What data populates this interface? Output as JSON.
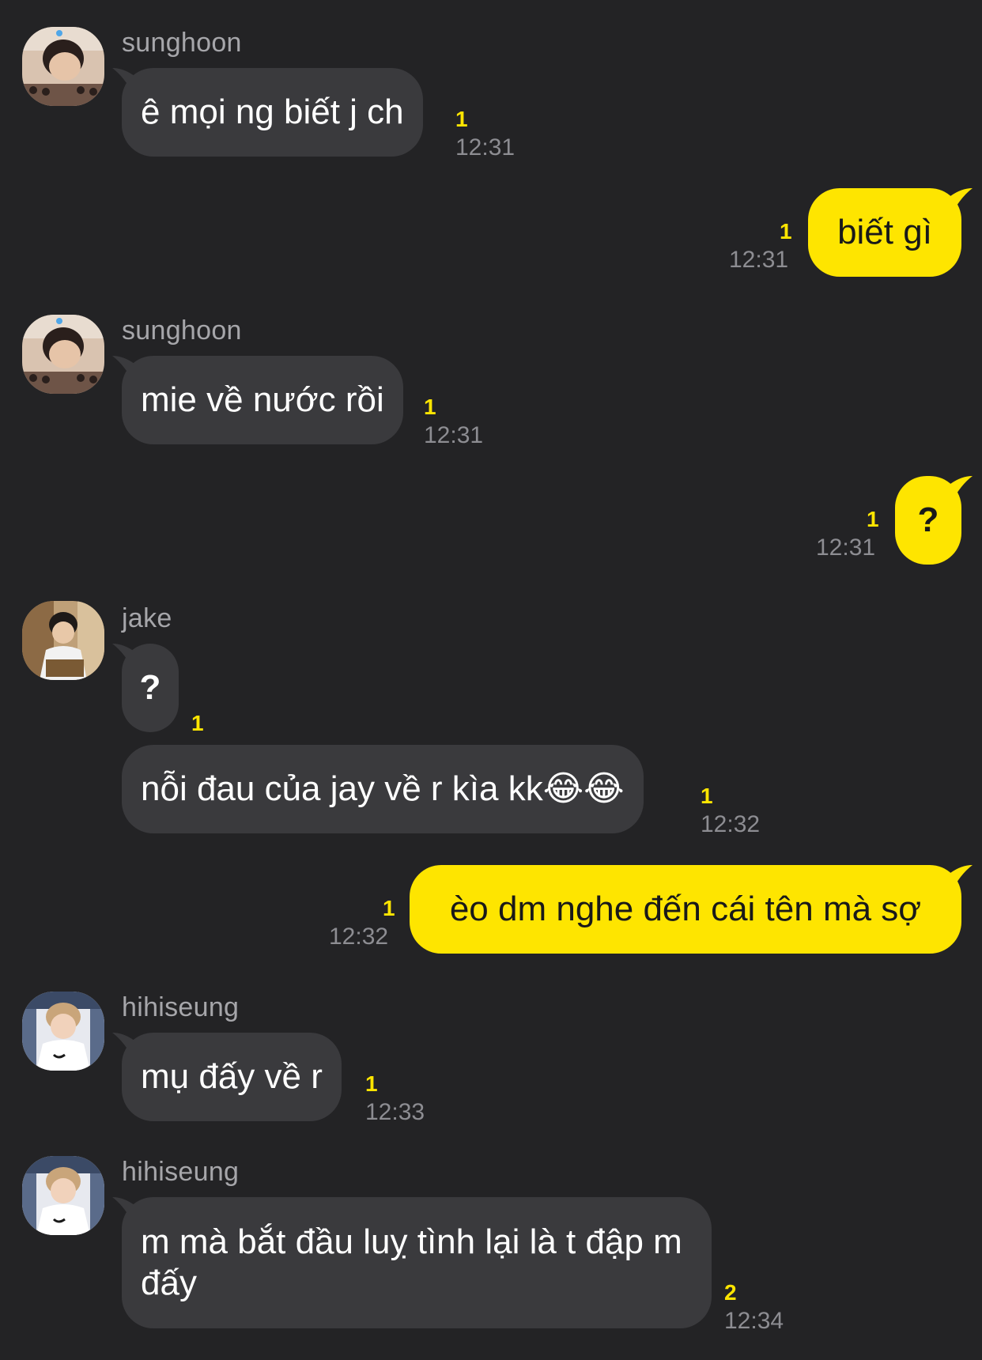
{
  "colors": {
    "background": "#232325",
    "incoming_bubble": "#3a3a3d",
    "outgoing_bubble": "#fee500",
    "unread_count": "#fee500",
    "timestamp": "#8d8d92",
    "sender_name": "#a6a6aa"
  },
  "messages": [
    {
      "sender": "sunghoon",
      "text": "ê mọi ng biết j ch",
      "unread": "1",
      "time": "12:31"
    },
    {
      "text": "biết gì",
      "unread": "1",
      "time": "12:31"
    },
    {
      "sender": "sunghoon",
      "text": "mie về nước rồi",
      "unread": "1",
      "time": "12:31"
    },
    {
      "text": "?",
      "unread": "1",
      "time": "12:31"
    },
    {
      "sender": "jake",
      "text": "?",
      "unread": "1"
    },
    {
      "text": "nỗi đau của jay về r kìa kk😂😂",
      "unread": "1",
      "time": "12:32"
    },
    {
      "text": "èo dm nghe đến cái tên mà sợ",
      "unread": "1",
      "time": "12:32"
    },
    {
      "sender": "hihiseung",
      "text": "mụ đấy về r",
      "unread": "1",
      "time": "12:33"
    },
    {
      "sender": "hihiseung",
      "text": "m mà bắt đầu luỵ tình lại là t đập m đấy",
      "unread": "2",
      "time": "12:34"
    }
  ]
}
